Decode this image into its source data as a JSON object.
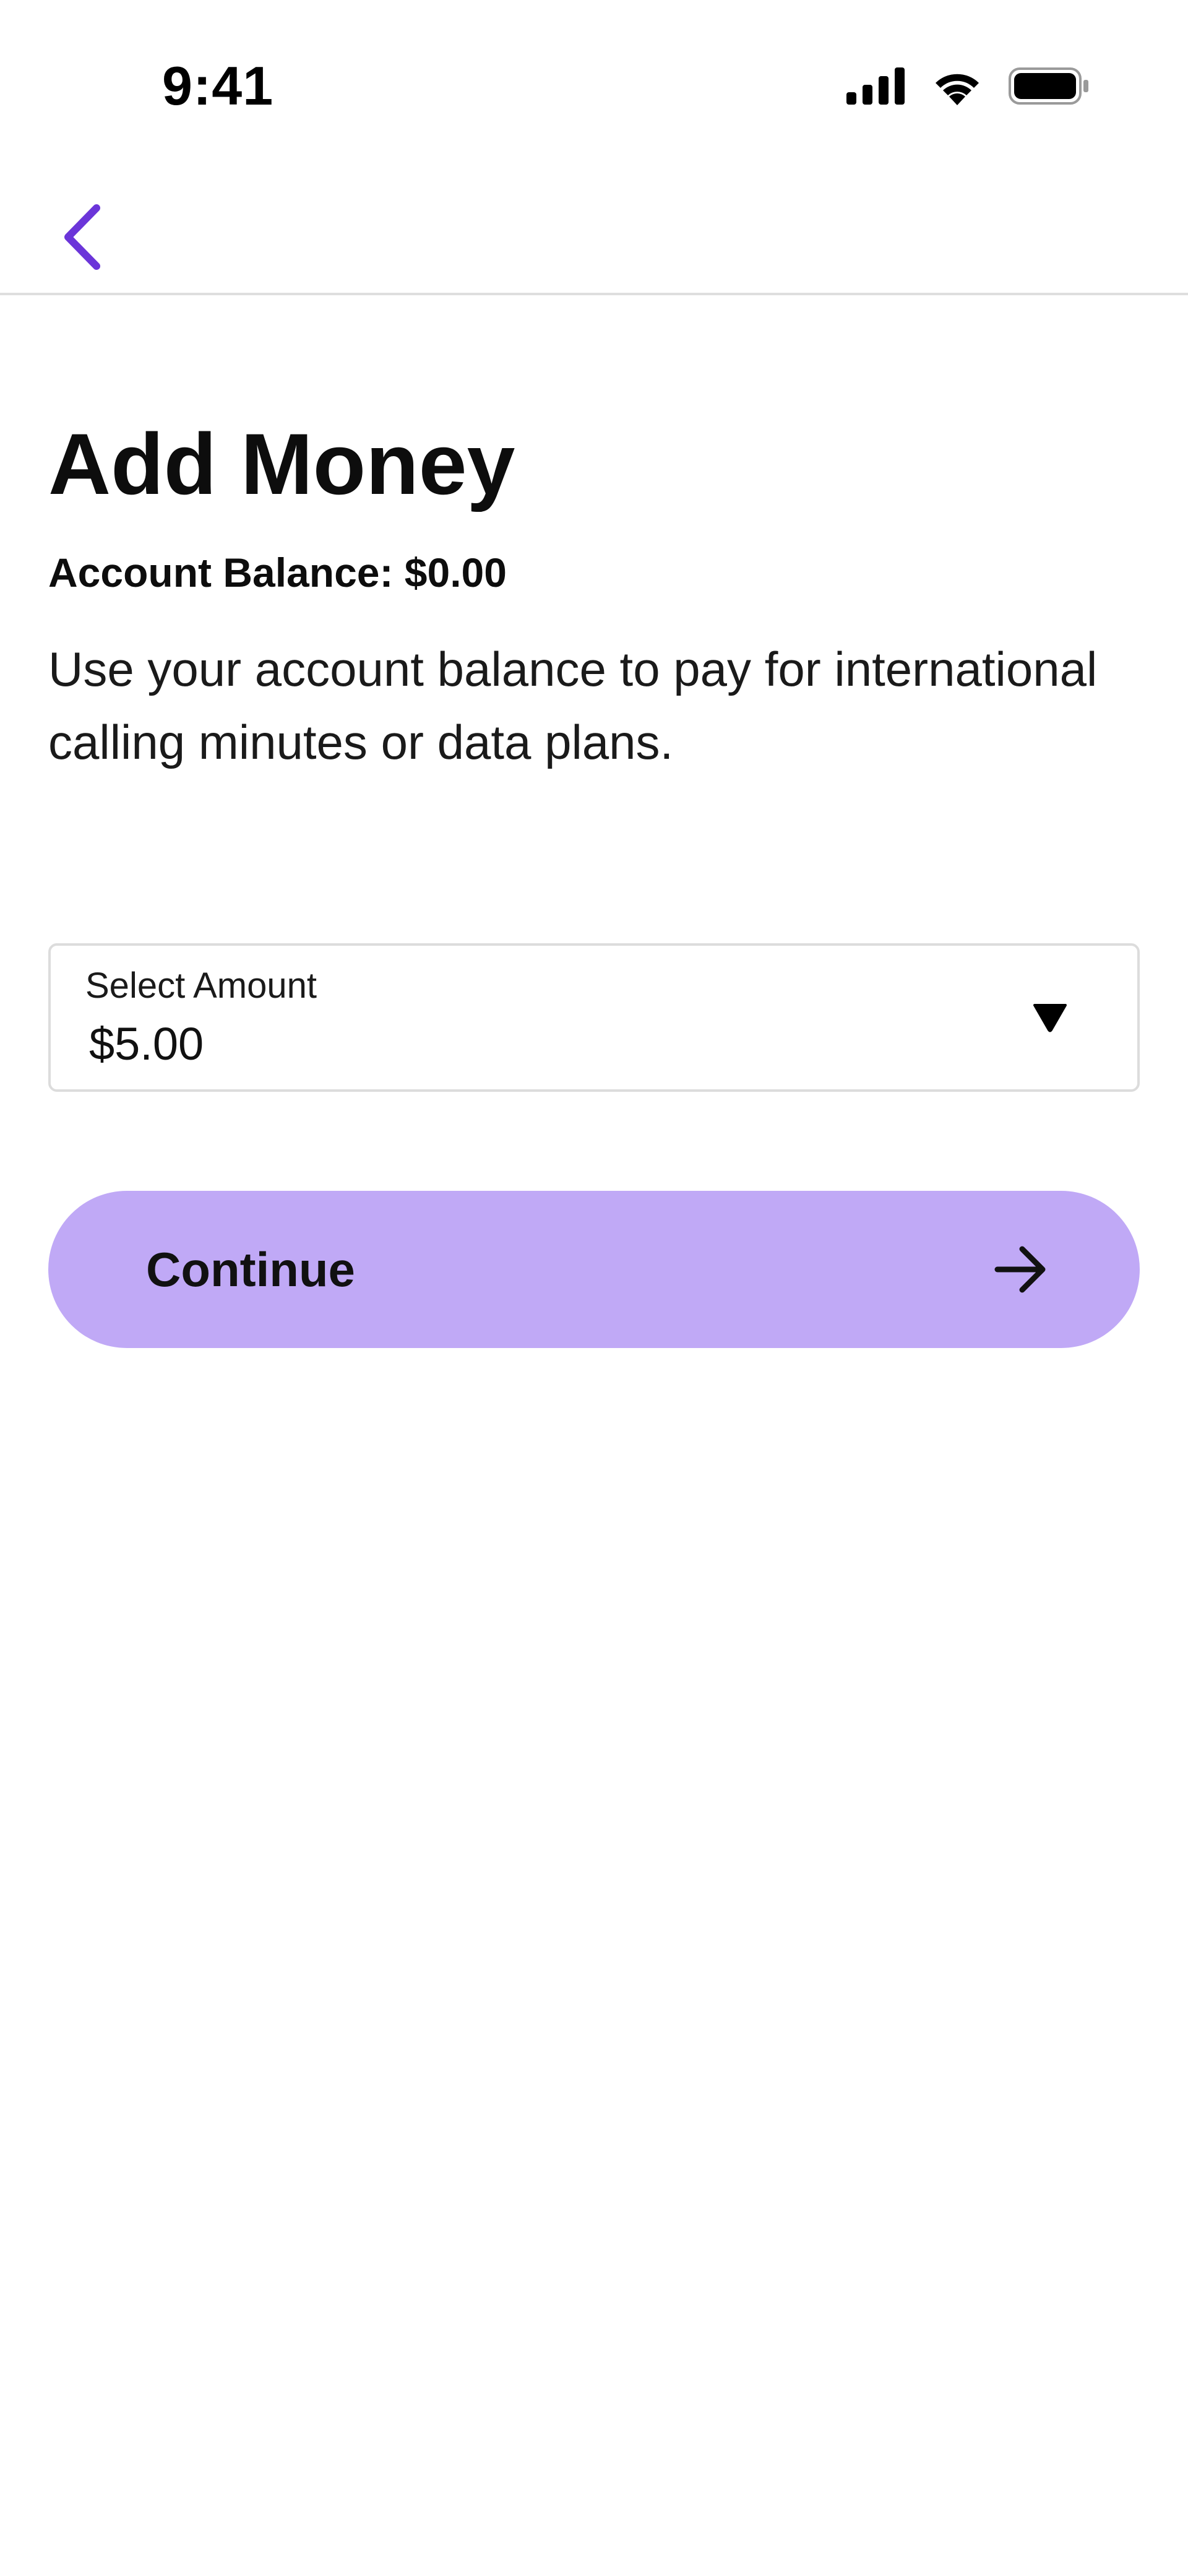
{
  "status_bar": {
    "time": "9:41",
    "icons": [
      "cellular-signal-icon",
      "wifi-icon",
      "battery-icon"
    ]
  },
  "nav": {
    "back_icon": "chevron-left-icon",
    "accent_color": "#6b35d9"
  },
  "page": {
    "title": "Add Money",
    "balance": "Account Balance: $0.00",
    "description": "Use your account balance to pay for international calling minutes or data plans."
  },
  "amount_select": {
    "label": "Select Amount",
    "value": "$5.00",
    "icon": "caret-down-icon"
  },
  "continue_button": {
    "label": "Continue",
    "icon": "arrow-right-icon",
    "color": "#c0a9f6"
  }
}
